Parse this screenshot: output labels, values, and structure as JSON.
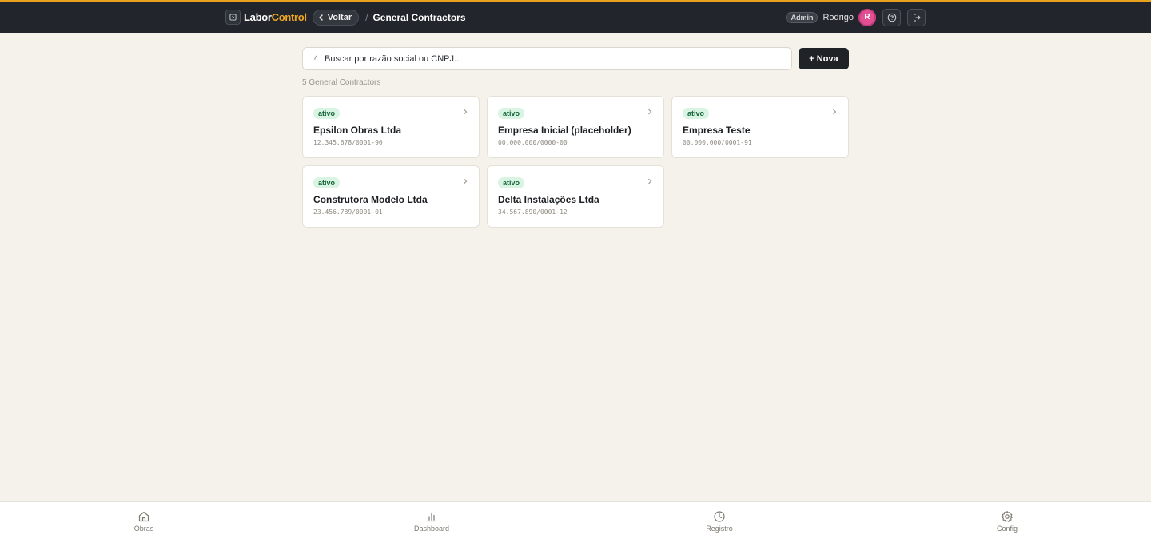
{
  "header": {
    "logo_part1": "Labor",
    "logo_part2": "Control",
    "back_label": "Voltar",
    "separator": "/",
    "title": "General Contractors",
    "role_badge": "Admin",
    "user_name": "Rodrigo",
    "avatar_initial": "R",
    "accent_color": "#e8a21c"
  },
  "search": {
    "placeholder": "Buscar por razão social ou CNPJ..."
  },
  "new_button_label": "+ Nova",
  "results_count": "5 General Contractors",
  "contractors": [
    {
      "status": "ativo",
      "name": "Epsilon Obras Ltda",
      "cnpj": "12.345.678/0001-90"
    },
    {
      "status": "ativo",
      "name": "Empresa Inicial (placeholder)",
      "cnpj": "00.000.000/0000-00"
    },
    {
      "status": "ativo",
      "name": "Empresa Teste",
      "cnpj": "00.000.000/0001-91"
    },
    {
      "status": "ativo",
      "name": "Construtora Modelo Ltda",
      "cnpj": "23.456.789/0001-01"
    },
    {
      "status": "ativo",
      "name": "Delta Instalações Ltda",
      "cnpj": "34.567.890/0001-12"
    }
  ],
  "bottom_nav": [
    {
      "label": "Obras",
      "icon": "home-icon"
    },
    {
      "label": "Dashboard",
      "icon": "bar-chart-icon"
    },
    {
      "label": "Registro",
      "icon": "clock-icon"
    },
    {
      "label": "Config",
      "icon": "gear-icon"
    }
  ]
}
